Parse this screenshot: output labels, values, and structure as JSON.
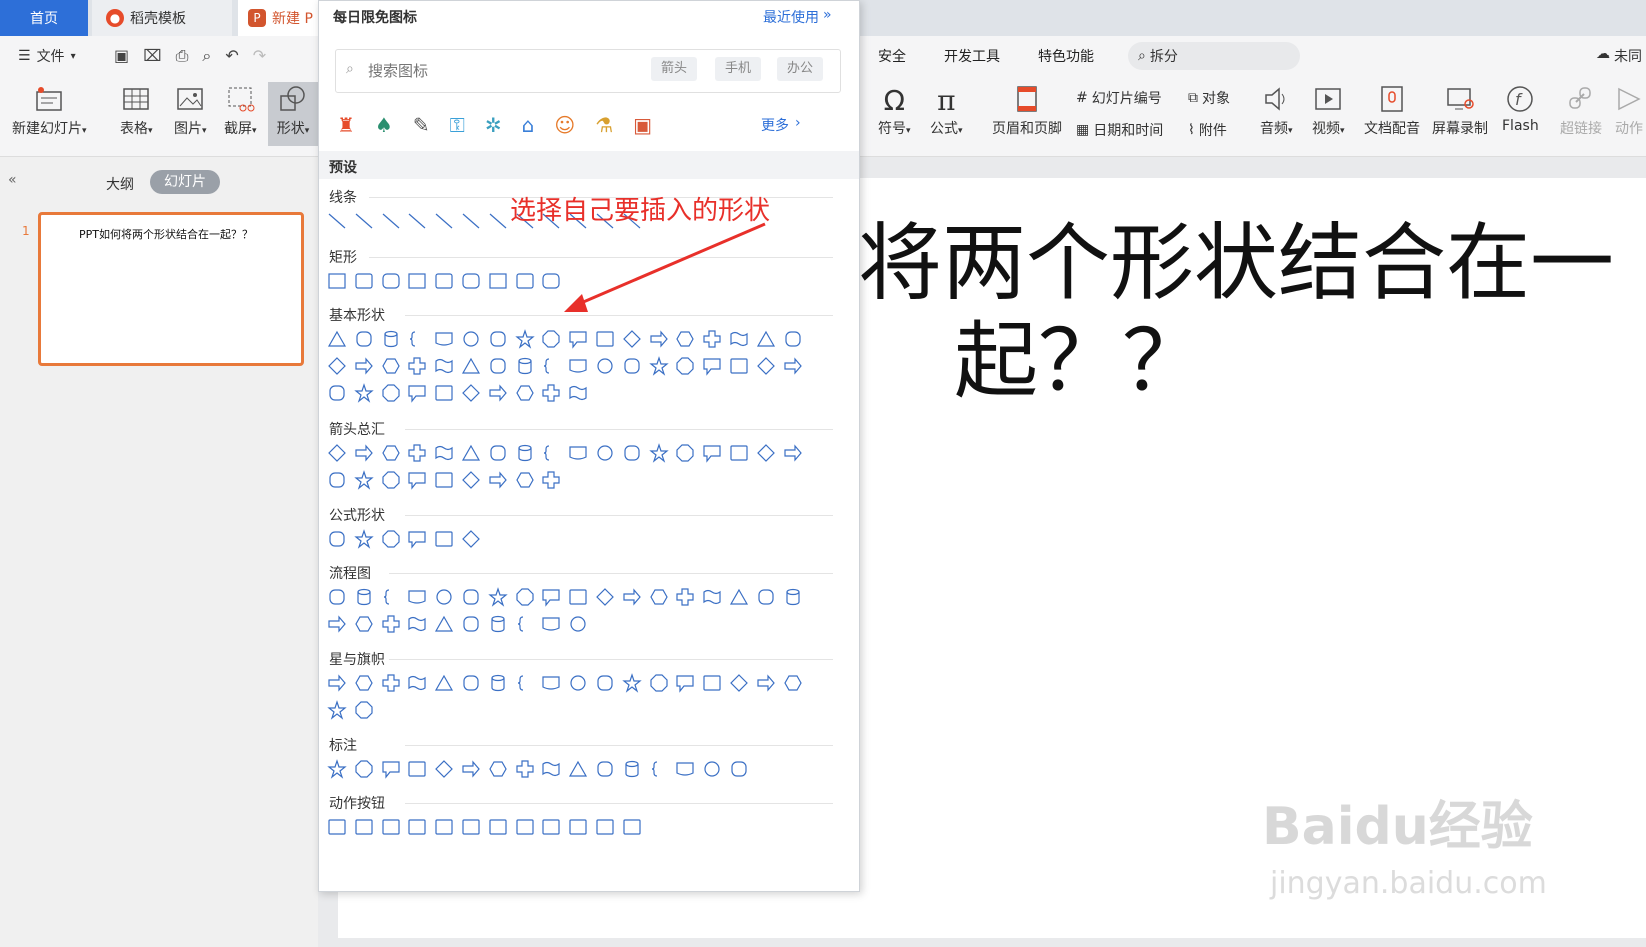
{
  "tabs": {
    "home": "首页",
    "template": "稻壳模板",
    "new_doc": "新建 P"
  },
  "menu": {
    "file": "文件",
    "right_items": [
      "安全",
      "开发工具",
      "特色功能"
    ],
    "search_text": "拆分",
    "cloud": "未同"
  },
  "ribbon_left": [
    {
      "label": "新建幻灯片",
      "arrow": true
    },
    {
      "label": "表格",
      "arrow": true
    },
    {
      "label": "图片",
      "arrow": true
    },
    {
      "label": "截屏",
      "arrow": true
    },
    {
      "label": "形状",
      "arrow": true
    }
  ],
  "ribbon_right": {
    "symbol": "符号",
    "formula": "公式",
    "header_footer": "页眉和页脚",
    "slide_number": "幻灯片编号",
    "object": "对象",
    "datetime": "日期和时间",
    "attachment": "附件",
    "audio": "音频",
    "video": "视频",
    "doc_voice": "文档配音",
    "screen_record": "屏幕录制",
    "flash": "Flash",
    "hyperlink": "超链接",
    "animation": "动作"
  },
  "leftpane": {
    "outline": "大纲",
    "slides": "幻灯片",
    "slide_number": "1",
    "thumb_text": "PPT如何将两个形状结合在一起？？"
  },
  "slide": {
    "title_line1": "将两个形状结合在一",
    "title_line2": "起？？"
  },
  "dropdown": {
    "header": "每日限免图标",
    "recent": "最近使用",
    "search_placeholder": "搜索图标",
    "chips": [
      "箭头",
      "手机",
      "办公"
    ],
    "more": "更多",
    "preset": "预设",
    "sections": [
      "线条",
      "矩形",
      "基本形状",
      "箭头总汇",
      "公式形状",
      "流程图",
      "星与旗帜",
      "标注",
      "动作按钮"
    ]
  },
  "annotation": "选择自己要插入的形状",
  "watermark": {
    "brand": "Baidu经验",
    "url": "jingyan.baidu.com"
  },
  "colors": {
    "accent": "#2d6fd8",
    "annotation": "#e8302a",
    "shape_stroke": "#3a6fc4",
    "thumb_border": "#e8793a"
  }
}
